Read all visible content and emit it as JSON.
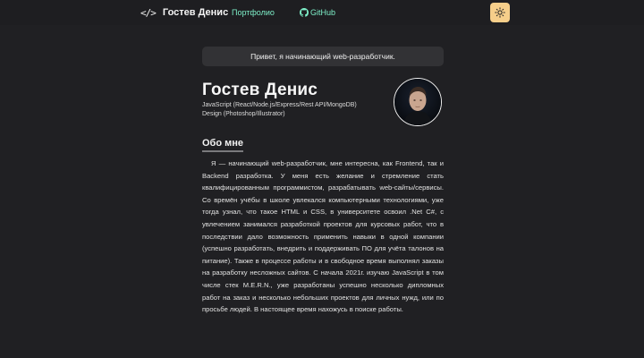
{
  "nav": {
    "logo_mark": "</>",
    "logo_text": "Гостев Денис",
    "links": [
      {
        "label": "Портфолио"
      },
      {
        "label": "GitHub"
      }
    ],
    "theme_icon": "sun-icon"
  },
  "greeting": "Привет, я начинающий web-разработчик.",
  "profile": {
    "name": "Гостев Денис",
    "skills": [
      "JavaScript (React/Node.js/Express/Rest API/MongoDB)",
      "Design (Photoshop/Illustrator)"
    ]
  },
  "about": {
    "title": "Обо мне",
    "text": "Я — начинающий web-разработчик, мне интересна, как Frontend, так и Backend разработка. У меня есть желание и стремление стать квалифицированным программистом, разрабатывать web-сайты/сервисы. Со времён учёбы в школе увлекался компьютерными технологиями, уже тогда узнал, что такое HTML и CSS, в университете освоил .Net C#, с увлечением занимался разработкой проектов для курсовых работ, что в последствии дало возможность применить навыки в одной компании (успешно разработать, внедрить и поддерживать ПО для учёта талонов на питание). Также в процессе работы и в свободное время выполнял заказы на разработку несложных сайтов. С начала 2021г. изучаю JavaScript в том числе стек M.E.R.N., уже разработаны успешно несколько дипломных работ на заказ и несколько небольших проектов для личных нужд, или по просьбе людей. В настоящее время нахожусь в поиске работы."
  },
  "colors": {
    "background": "#202023",
    "accent": "#7ef0c9",
    "theme_button": "#f6ce8a",
    "card": "#323235"
  }
}
